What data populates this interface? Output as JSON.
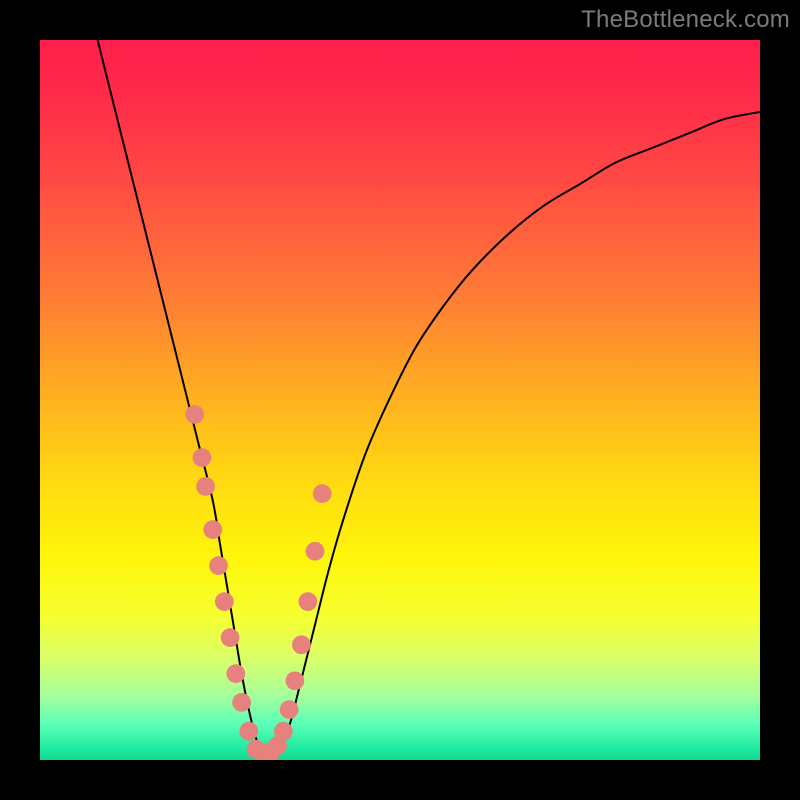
{
  "watermark": {
    "text": "TheBottleneck.com"
  },
  "colors": {
    "frame": "#000000",
    "curve": "#000000",
    "dots": "#e6817e",
    "gradient_stops": [
      {
        "offset": 0.0,
        "color": "#ff1f4b"
      },
      {
        "offset": 0.08,
        "color": "#ff2b4a"
      },
      {
        "offset": 0.2,
        "color": "#ff4b43"
      },
      {
        "offset": 0.35,
        "color": "#ff7a35"
      },
      {
        "offset": 0.5,
        "color": "#ffb21f"
      },
      {
        "offset": 0.62,
        "color": "#ffdc10"
      },
      {
        "offset": 0.72,
        "color": "#fff60a"
      },
      {
        "offset": 0.8,
        "color": "#f6ff30"
      },
      {
        "offset": 0.86,
        "color": "#d8ff6a"
      },
      {
        "offset": 0.91,
        "color": "#a6ff9a"
      },
      {
        "offset": 0.95,
        "color": "#5cffb8"
      },
      {
        "offset": 0.985,
        "color": "#1de9a0"
      },
      {
        "offset": 1.0,
        "color": "#18d890"
      }
    ]
  },
  "chart_data": {
    "type": "line",
    "title": "",
    "xlabel": "",
    "ylabel": "",
    "xlim": [
      0,
      100
    ],
    "ylim": [
      0,
      100
    ],
    "grid": false,
    "legend": false,
    "series": [
      {
        "name": "bottleneck-curve",
        "x": [
          8,
          10,
          12,
          14,
          16,
          18,
          20,
          22,
          24,
          25,
          26,
          27,
          28,
          29,
          30,
          31,
          32,
          33,
          34,
          35,
          36,
          38,
          40,
          42,
          45,
          48,
          52,
          56,
          60,
          65,
          70,
          75,
          80,
          85,
          90,
          95,
          100
        ],
        "y": [
          100,
          92,
          84,
          76,
          68,
          60,
          52,
          44,
          36,
          30,
          24,
          18,
          12,
          7,
          3,
          1,
          0,
          1,
          3,
          6,
          10,
          18,
          26,
          33,
          42,
          49,
          57,
          63,
          68,
          73,
          77,
          80,
          83,
          85,
          87,
          89,
          90
        ]
      }
    ],
    "annotations": {
      "dot_cluster": {
        "description": "points highlighted along the curve near the minimum",
        "x": [
          21.5,
          22.5,
          23.0,
          24.0,
          24.8,
          25.6,
          26.4,
          27.2,
          28.0,
          29.0,
          30.0,
          31.0,
          32.0,
          33.0,
          33.8,
          34.6,
          35.4,
          36.3,
          37.2,
          38.2,
          39.2
        ],
        "y": [
          48,
          42,
          38,
          32,
          27,
          22,
          17,
          12,
          8,
          4,
          1.5,
          1,
          1,
          2,
          4,
          7,
          11,
          16,
          22,
          29,
          37
        ]
      }
    }
  }
}
